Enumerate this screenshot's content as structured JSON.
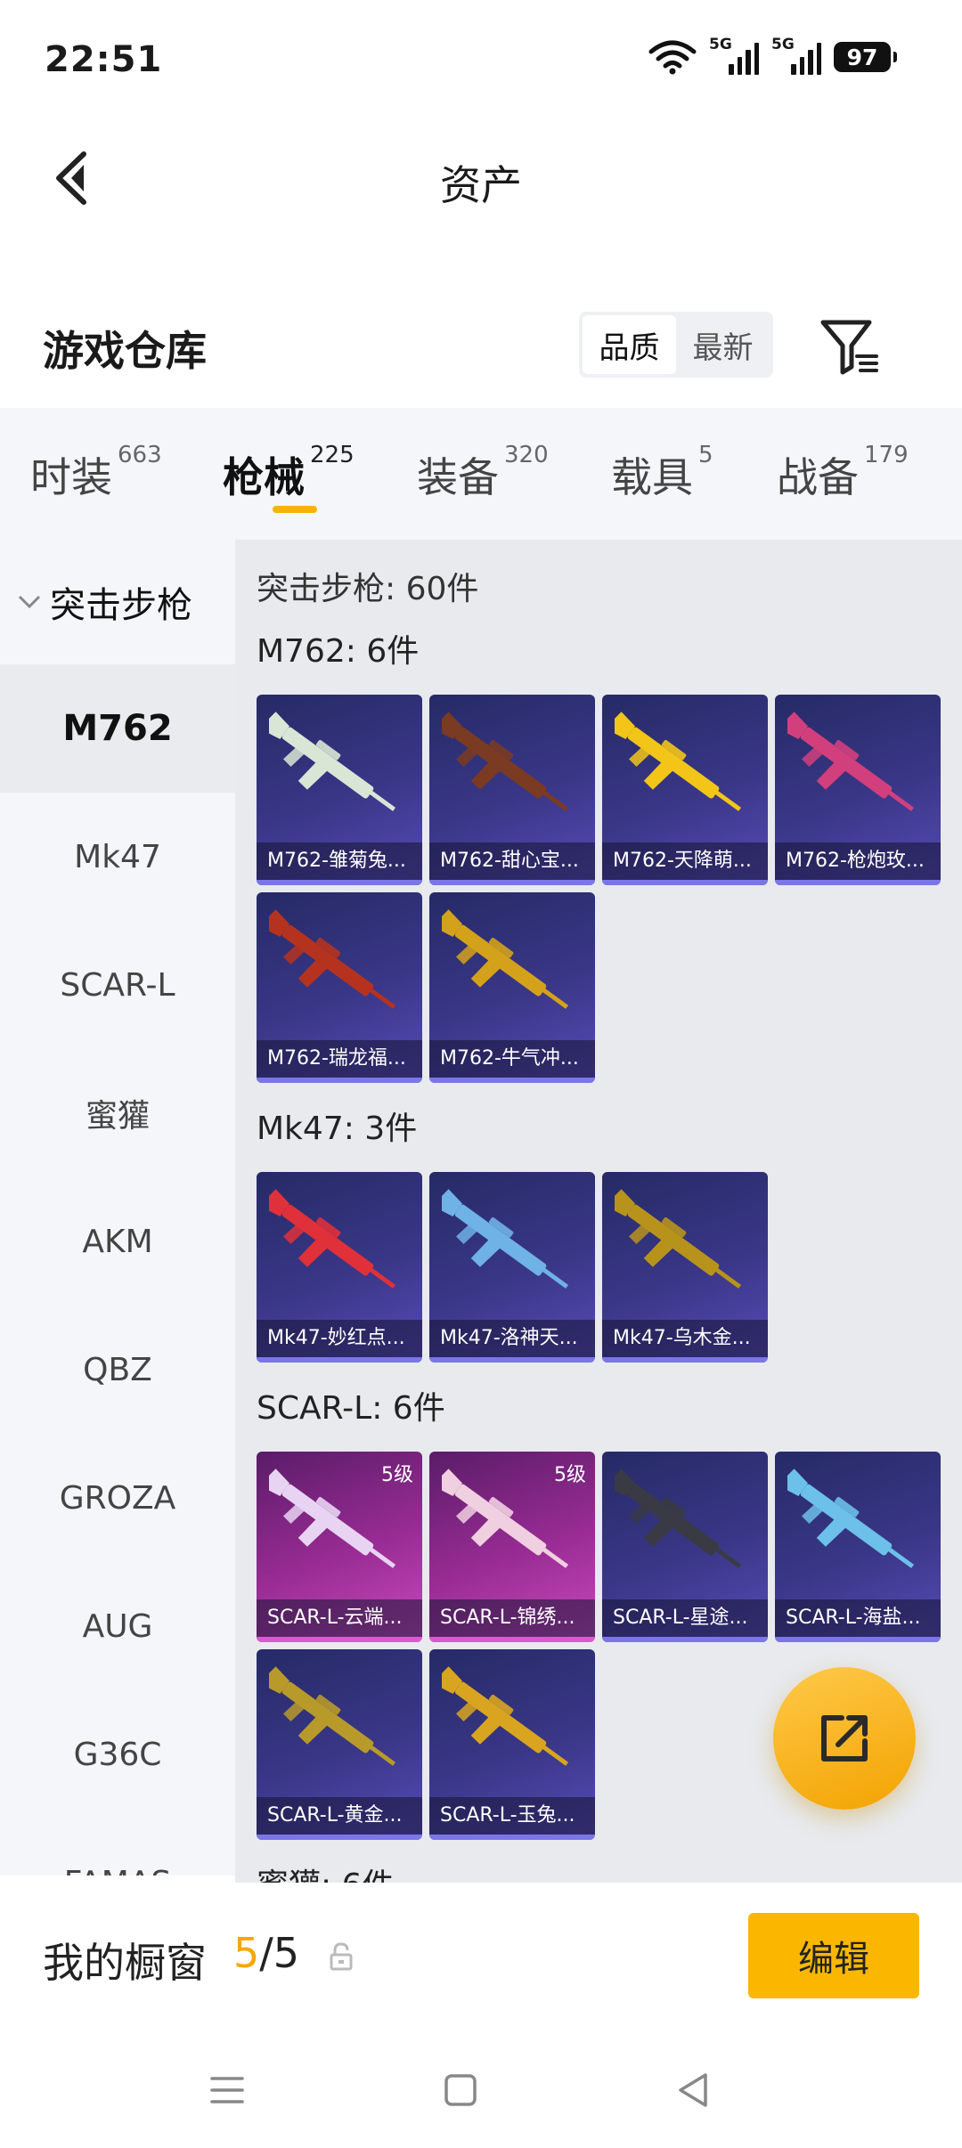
{
  "status_bar": {
    "time": "22:51",
    "sim1": "5G",
    "sim2": "5G",
    "battery": "97"
  },
  "header": {
    "title": "资产"
  },
  "section": {
    "title": "游戏仓库",
    "sort_options": [
      "品质",
      "最新"
    ],
    "sort_selected": "品质"
  },
  "tabs": [
    {
      "label": "时装",
      "count": "663"
    },
    {
      "label": "枪械",
      "count": "225",
      "active": true
    },
    {
      "label": "装备",
      "count": "320"
    },
    {
      "label": "载具",
      "count": "5"
    },
    {
      "label": "战备",
      "count": "179"
    }
  ],
  "sidebar": {
    "group": "突击步枪",
    "items": [
      "M762",
      "Mk47",
      "SCAR-L",
      "蜜獾",
      "AKM",
      "QBZ",
      "GROZA",
      "AUG",
      "G36C",
      "FAMAS"
    ],
    "active": "M762"
  },
  "main": {
    "title": "突击步枪: 60件",
    "groups": [
      {
        "label": "M762: 6件",
        "items": [
          {
            "name": "M762-雏菊兔...",
            "gun": "#d9e6d6"
          },
          {
            "name": "M762-甜心宝...",
            "gun": "#7a3b22"
          },
          {
            "name": "M762-天降萌...",
            "gun": "#f2c518"
          },
          {
            "name": "M762-枪炮玫...",
            "gun": "#d23f7d"
          },
          {
            "name": "M762-瑞龙福...",
            "gun": "#b5331e"
          },
          {
            "name": "M762-牛气冲...",
            "gun": "#d4a21a"
          }
        ]
      },
      {
        "label": "Mk47: 3件",
        "items": [
          {
            "name": "Mk47-妙红点...",
            "gun": "#e0303a"
          },
          {
            "name": "Mk47-洛神天...",
            "gun": "#6fb2e6"
          },
          {
            "name": "Mk47-乌木金...",
            "gun": "#b8931c"
          }
        ]
      },
      {
        "label": "SCAR-L: 6件",
        "items": [
          {
            "name": "SCAR-L-云端...",
            "gun": "#e8d4f2",
            "level": "5级"
          },
          {
            "name": "SCAR-L-锦绣...",
            "gun": "#f0cfe0",
            "level": "5级"
          },
          {
            "name": "SCAR-L-星途...",
            "gun": "#3a3a44"
          },
          {
            "name": "SCAR-L-海盐...",
            "gun": "#6cc0ea"
          },
          {
            "name": "SCAR-L-黄金...",
            "gun": "#b89a2a"
          },
          {
            "name": "SCAR-L-玉兔...",
            "gun": "#d9a520"
          }
        ]
      },
      {
        "label": "蜜獾: 6件",
        "items": []
      }
    ]
  },
  "showcase": {
    "label": "我的橱窗",
    "current": "5",
    "total": "5",
    "edit_label": "编辑"
  },
  "colors": {
    "accent": "#f5b400",
    "card_bg": "#3a3788",
    "card_pink": "#9a2c95"
  },
  "icons": {
    "back": "chevron-left-icon",
    "filter": "filter-icon",
    "share": "share-icon",
    "lock": "lock-icon",
    "nav": [
      "menu-icon",
      "home-icon",
      "back-triangle-icon"
    ]
  }
}
